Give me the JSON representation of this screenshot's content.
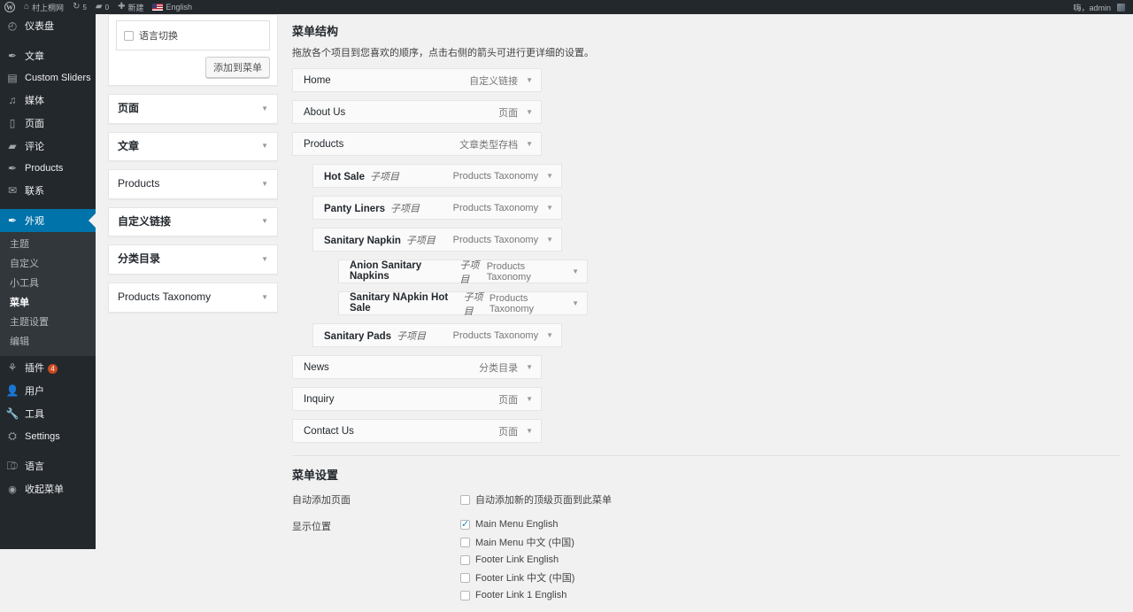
{
  "adminbar": {
    "logo_icon": "wordpress-logo-icon",
    "items": [
      {
        "icon": "home-icon",
        "glyph": "⌂",
        "label": "村上桐网",
        "name": "site-name"
      },
      {
        "icon": "updates-icon",
        "glyph": "↻",
        "label": "5",
        "name": "updates"
      },
      {
        "icon": "comments-icon",
        "glyph": "▰",
        "label": "0",
        "name": "comments"
      },
      {
        "icon": "plus-icon",
        "glyph": "✚",
        "label": "新建",
        "name": "new-content"
      },
      {
        "icon": "flag-icon",
        "glyph": "",
        "label": "English",
        "name": "language"
      }
    ],
    "account_greeting": "嗨，admin"
  },
  "sidebar": {
    "items": [
      {
        "label": "仪表盘",
        "icon": "dashboard-icon",
        "glyph": "◴",
        "current": false,
        "sep_after": true
      },
      {
        "label": "文章",
        "icon": "posts-pin-icon",
        "glyph": "✒",
        "current": false
      },
      {
        "label": "Custom Sliders",
        "icon": "slider-image-icon",
        "glyph": "▤",
        "current": false
      },
      {
        "label": "媒体",
        "icon": "media-icon",
        "glyph": "♫",
        "current": false
      },
      {
        "label": "页面",
        "icon": "pages-icon",
        "glyph": "▯",
        "current": false
      },
      {
        "label": "评论",
        "icon": "comments-icon",
        "glyph": "▰",
        "current": false
      },
      {
        "label": "Products",
        "icon": "products-pin-icon",
        "glyph": "✒",
        "current": false
      },
      {
        "label": "联系",
        "icon": "mail-icon",
        "glyph": "✉",
        "current": false,
        "sep_after": true
      },
      {
        "label": "外观",
        "icon": "appearance-brush-icon",
        "glyph": "✒",
        "current": true
      }
    ],
    "submenu": [
      {
        "label": "主题",
        "current": false
      },
      {
        "label": "自定义",
        "current": false
      },
      {
        "label": "小工具",
        "current": false
      },
      {
        "label": "菜单",
        "current": true
      },
      {
        "label": "主题设置",
        "current": false
      },
      {
        "label": "编辑",
        "current": false
      }
    ],
    "items_after": [
      {
        "label": "插件",
        "icon": "plugins-icon",
        "glyph": "⚘",
        "badge": "4",
        "current": false
      },
      {
        "label": "用户",
        "icon": "users-icon",
        "glyph": "👤",
        "current": false
      },
      {
        "label": "工具",
        "icon": "tools-wrench-icon",
        "glyph": "🔧",
        "current": false
      },
      {
        "label": "Settings",
        "icon": "settings-icon",
        "glyph": "⛭",
        "current": false,
        "sep_after": true
      },
      {
        "label": "语言",
        "icon": "language-icon",
        "glyph": "⎄",
        "current": false
      }
    ],
    "collapse": {
      "label": "收起菜单",
      "icon": "collapse-arrow-icon",
      "glyph": "◉"
    }
  },
  "left_panel": {
    "language_switcher": {
      "label": "语言切换",
      "checked": false
    },
    "add_to_menu_button": "添加到菜单",
    "accordions": [
      {
        "label": "页面",
        "cjk": true,
        "icon": "chevron-down-icon"
      },
      {
        "label": "文章",
        "cjk": true,
        "icon": "chevron-down-icon"
      },
      {
        "label": "Products",
        "cjk": false,
        "icon": "chevron-down-icon"
      },
      {
        "label": "自定义链接",
        "cjk": true,
        "icon": "chevron-down-icon"
      },
      {
        "label": "分类目录",
        "cjk": true,
        "icon": "chevron-down-icon"
      },
      {
        "label": "Products Taxonomy",
        "cjk": false,
        "icon": "chevron-down-icon"
      }
    ],
    "caret_glyph": "▼"
  },
  "menu_structure": {
    "title": "菜单结构",
    "description": "拖放各个项目到您喜欢的顺序，点击右侧的箭头可进行更详细的设置。",
    "caret_glyph": "▼",
    "items": [
      {
        "title": "Home",
        "sub": "",
        "type": "自定义链接",
        "depth": 0
      },
      {
        "title": "About Us",
        "sub": "",
        "type": "页面",
        "depth": 0
      },
      {
        "title": "Products",
        "sub": "",
        "type": "文章类型存档",
        "depth": 0
      },
      {
        "title": "Hot Sale",
        "sub": "子项目",
        "type": "Products Taxonomy",
        "depth": 1
      },
      {
        "title": "Panty Liners",
        "sub": "子项目",
        "type": "Products Taxonomy",
        "depth": 1
      },
      {
        "title": "Sanitary Napkin",
        "sub": "子项目",
        "type": "Products Taxonomy",
        "depth": 1
      },
      {
        "title": "Anion Sanitary Napkins",
        "sub": "子项目",
        "type": "Products Taxonomy",
        "depth": 2
      },
      {
        "title": "Sanitary NApkin Hot Sale",
        "sub": "子项目",
        "type": "Products Taxonomy",
        "depth": 2
      },
      {
        "title": "Sanitary Pads",
        "sub": "子项目",
        "type": "Products Taxonomy",
        "depth": 1
      },
      {
        "title": "News",
        "sub": "",
        "type": "分类目录",
        "depth": 0
      },
      {
        "title": "Inquiry",
        "sub": "",
        "type": "页面",
        "depth": 0
      },
      {
        "title": "Contact Us",
        "sub": "",
        "type": "页面",
        "depth": 0
      }
    ]
  },
  "menu_settings": {
    "title": "菜单设置",
    "auto_add_label": "自动添加页面",
    "auto_add_option": {
      "label": "自动添加新的顶级页面到此菜单",
      "checked": false
    },
    "display_location_label": "显示位置",
    "locations": [
      {
        "label": "Main Menu English",
        "checked": true
      },
      {
        "label": "Main Menu 中文 (中国)",
        "checked": false
      },
      {
        "label": "Footer Link English",
        "checked": false
      },
      {
        "label": "Footer Link 中文 (中国)",
        "checked": false
      },
      {
        "label": "Footer Link 1 English",
        "checked": false
      }
    ]
  },
  "colors": {
    "admin_bar_bg": "#23282d",
    "sidebar_bg": "#23282d",
    "submenu_bg": "#32373c",
    "accent_blue": "#0073aa",
    "badge_orange": "#ca4a1f",
    "content_bg": "#f1f1f1"
  }
}
